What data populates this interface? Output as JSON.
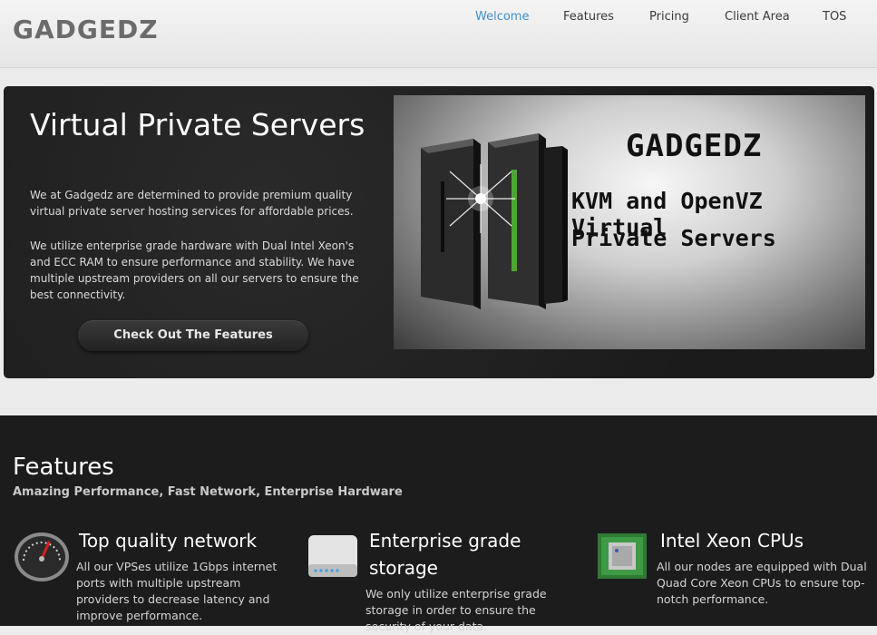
{
  "header": {
    "logo": "GADGEDZ",
    "nav": [
      {
        "label": "Welcome",
        "active": true
      },
      {
        "label": "Features",
        "active": false
      },
      {
        "label": "Pricing",
        "active": false
      },
      {
        "label": "Client Area",
        "active": false
      },
      {
        "label": "TOS",
        "active": false
      }
    ]
  },
  "hero": {
    "title": "Virtual Private Servers",
    "paragraph1": "We at Gadgedz are determined to provide premium quality virtual private server hosting services for affordable prices.",
    "paragraph2": "We utilize enterprise grade hardware with Dual Intel Xeon's and ECC RAM to ensure performance and stability. We have multiple upstream providers on all our servers to ensure the best connectivity.",
    "button_label": "Check Out The Features",
    "banner": {
      "logo": "GADGEDZ",
      "line1": "KVM and OpenVZ Virtual",
      "line2": "Private Servers"
    }
  },
  "features": {
    "title": "Features",
    "subtitle": "Amazing Performance, Fast Network, Enterprise Hardware",
    "items": [
      {
        "icon": "speedometer-icon",
        "title": "Top quality network",
        "description": "All our VPSes utilize 1Gbps internet ports with multiple upstream providers to decrease latency and improve performance."
      },
      {
        "icon": "hard-drive-icon",
        "title": "Enterprise grade storage",
        "description": "We only utilize enterprise grade storage in order to ensure the security of your data."
      },
      {
        "icon": "cpu-chip-icon",
        "title": "Intel Xeon CPUs",
        "description": "All our nodes are equipped with Dual Quad Core Xeon CPUs to ensure top-notch performance."
      }
    ]
  },
  "colors": {
    "accent": "#3d8fd0",
    "hero_bg": "#1e1e1e",
    "features_bg": "#1c1c1c"
  }
}
